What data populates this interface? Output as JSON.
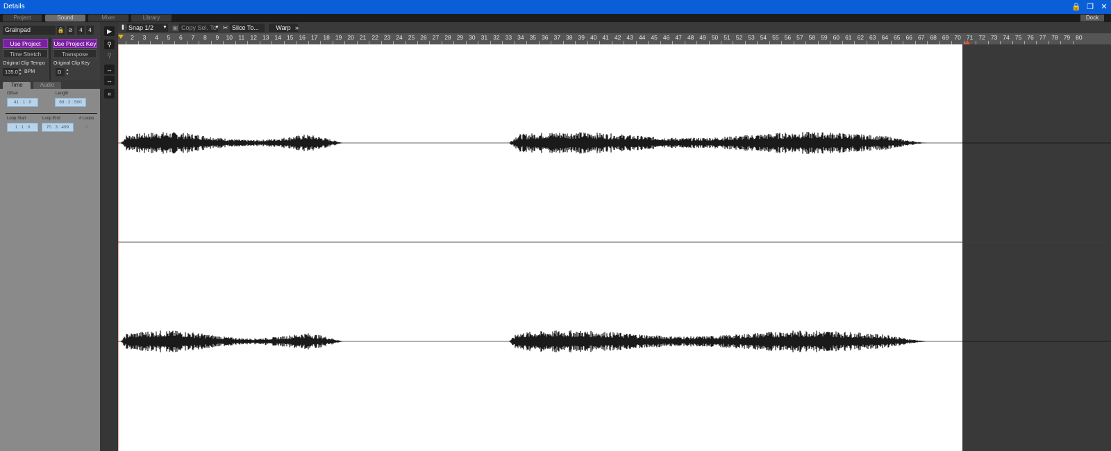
{
  "window": {
    "title": "Details"
  },
  "title_icons": {
    "lock": "lock-icon",
    "restore": "restore-icon",
    "close": "close-icon"
  },
  "main_tabs": [
    {
      "label": "Project",
      "active": false
    },
    {
      "label": "Sound",
      "active": true
    },
    {
      "label": "Mixer",
      "active": false
    },
    {
      "label": "Library",
      "active": false
    }
  ],
  "dock_label": "Dock",
  "clip": {
    "name": "Grainpad",
    "time_sig_num": "4",
    "time_sig_den": "4",
    "use_tempo_label": "Use Project Tempo",
    "time_stretch_label": "Time Stretch",
    "use_key_label": "Use Project Key",
    "transpose_label": "Transpose",
    "orig_tempo_label": "Original Clip Tempo",
    "orig_tempo_value": "135.0",
    "bpm_label": "BPM",
    "orig_key_label": "Original Clip Key",
    "orig_key_value": "D"
  },
  "sub_tabs": [
    {
      "label": "Time",
      "active": true
    },
    {
      "label": "Audio",
      "active": false
    }
  ],
  "time": {
    "offset_label": "Offset",
    "offset_value": "41 : 1 : 0",
    "length_label": "Length",
    "length_value": "69 : 2 : 500",
    "loop_start_label": "Loop Start",
    "loop_start_value": "1 : 1 : 0",
    "loop_end_label": "Loop End",
    "loop_end_value": "70 : 3 : 499",
    "loops_label": "# Loops",
    "loops_value": "1"
  },
  "toolbar": {
    "snap_label": "Snap 1/2",
    "copy_label": "Copy Sel. To",
    "slice_label": "Slice To...",
    "warp_label": "Warp",
    "more_label": "»"
  },
  "ruler": {
    "start": 1,
    "end": 80,
    "labels": [
      "2",
      "3",
      "4",
      "5",
      "6",
      "7",
      "8",
      "9",
      "10",
      "11",
      "12",
      "13",
      "14",
      "15",
      "16",
      "17",
      "18",
      "19",
      "20",
      "21",
      "22",
      "23",
      "24",
      "25",
      "26",
      "27",
      "28",
      "29",
      "30",
      "31",
      "32",
      "33",
      "34",
      "35",
      "36",
      "37",
      "38",
      "39",
      "40",
      "41",
      "42",
      "43",
      "44",
      "45",
      "46",
      "47",
      "48",
      "49",
      "50",
      "51",
      "52",
      "53",
      "54",
      "55",
      "56",
      "57",
      "58",
      "59",
      "60",
      "61",
      "62",
      "63",
      "64",
      "65",
      "66",
      "67",
      "68",
      "69",
      "70",
      "71",
      "72",
      "73",
      "74",
      "75",
      "76",
      "77",
      "78",
      "79",
      "80"
    ]
  },
  "clip_end_bar": 71,
  "colors": {
    "titlebar": "#0a5fd8",
    "accent_purple": "#7b1fa2",
    "waveform_bg": "#ffffff",
    "waveform": "#1a1a1a",
    "clip_marker": "#e8532a"
  }
}
